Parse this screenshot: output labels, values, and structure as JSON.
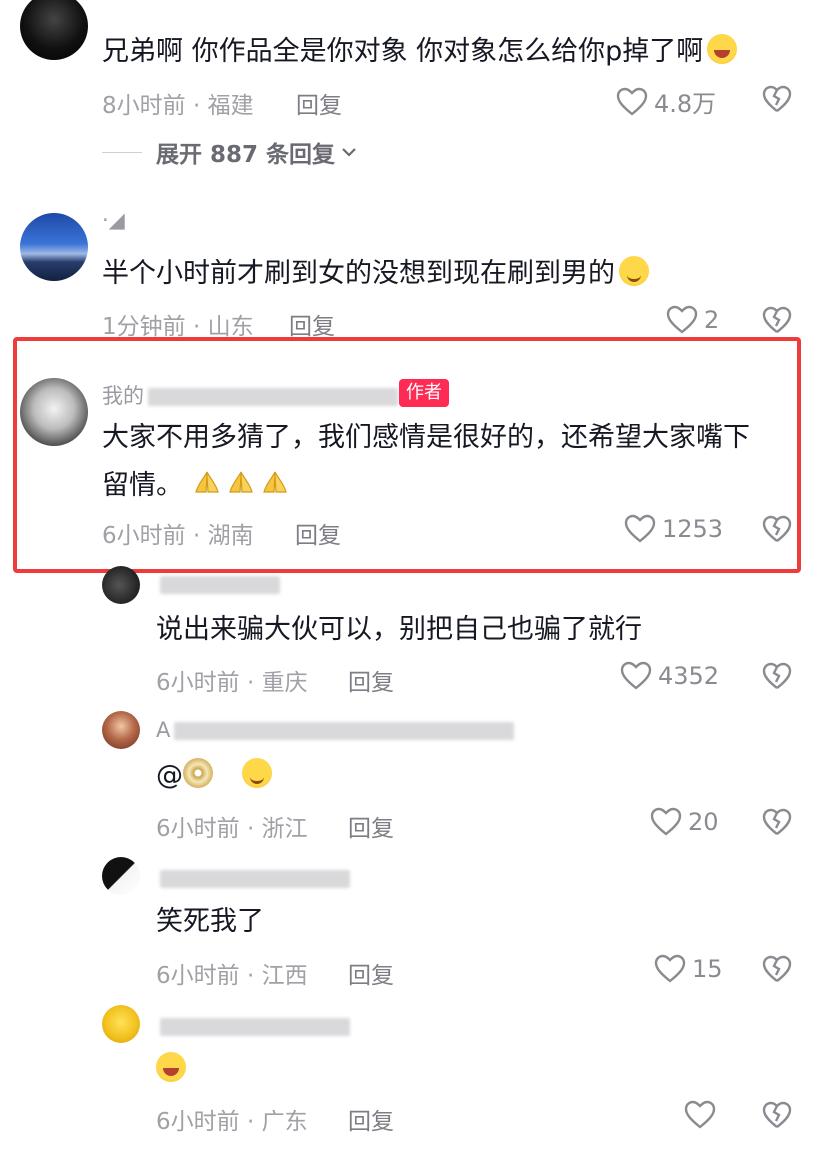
{
  "comments": [
    {
      "text": "兄弟啊  你作品全是你对象  你对象怎么给你p掉了啊",
      "emoji": "crying-laughing-emoji",
      "time_location": "8小时前 · 福建",
      "reply_label": "回复",
      "likes": "4.8万"
    },
    {
      "username": "·◢",
      "text": "半个小时前才刷到女的没想到现在刷到男的",
      "emoji": "smirk-emoji",
      "time_location": "1分钟前 · 山东",
      "reply_label": "回复",
      "likes": "2"
    },
    {
      "username": "我的",
      "author_tag": "作者",
      "text_line1": "大家不用多猜了，我们感情是很好的，还希望大家嘴下",
      "text_line2": "留情。",
      "emoji": "praying-hands-emoji",
      "time_location": "6小时前 · 湖南",
      "reply_label": "回复",
      "likes": "1253"
    }
  ],
  "expand_replies": "展开 887 条回复",
  "replies": [
    {
      "username": "",
      "text": "说出来骗大伙可以，别把自己也骗了就行",
      "time_location": "6小时前 · 重庆",
      "reply_label": "回复",
      "likes": "4352"
    },
    {
      "username": "A",
      "text": "@",
      "time_location": "6小时前 · 浙江",
      "reply_label": "回复",
      "likes": "20"
    },
    {
      "username": "",
      "text": "笑死我了",
      "time_location": "6小时前 · 江西",
      "reply_label": "回复",
      "likes": "15"
    },
    {
      "username": "",
      "text": "",
      "time_location": "6小时前 · 广东",
      "reply_label": "回复",
      "likes": ""
    }
  ],
  "colors": {
    "highlight_border": "#ee3b3b",
    "author_tag": "#fe2c55",
    "meta_text": "#a0a1a6"
  }
}
